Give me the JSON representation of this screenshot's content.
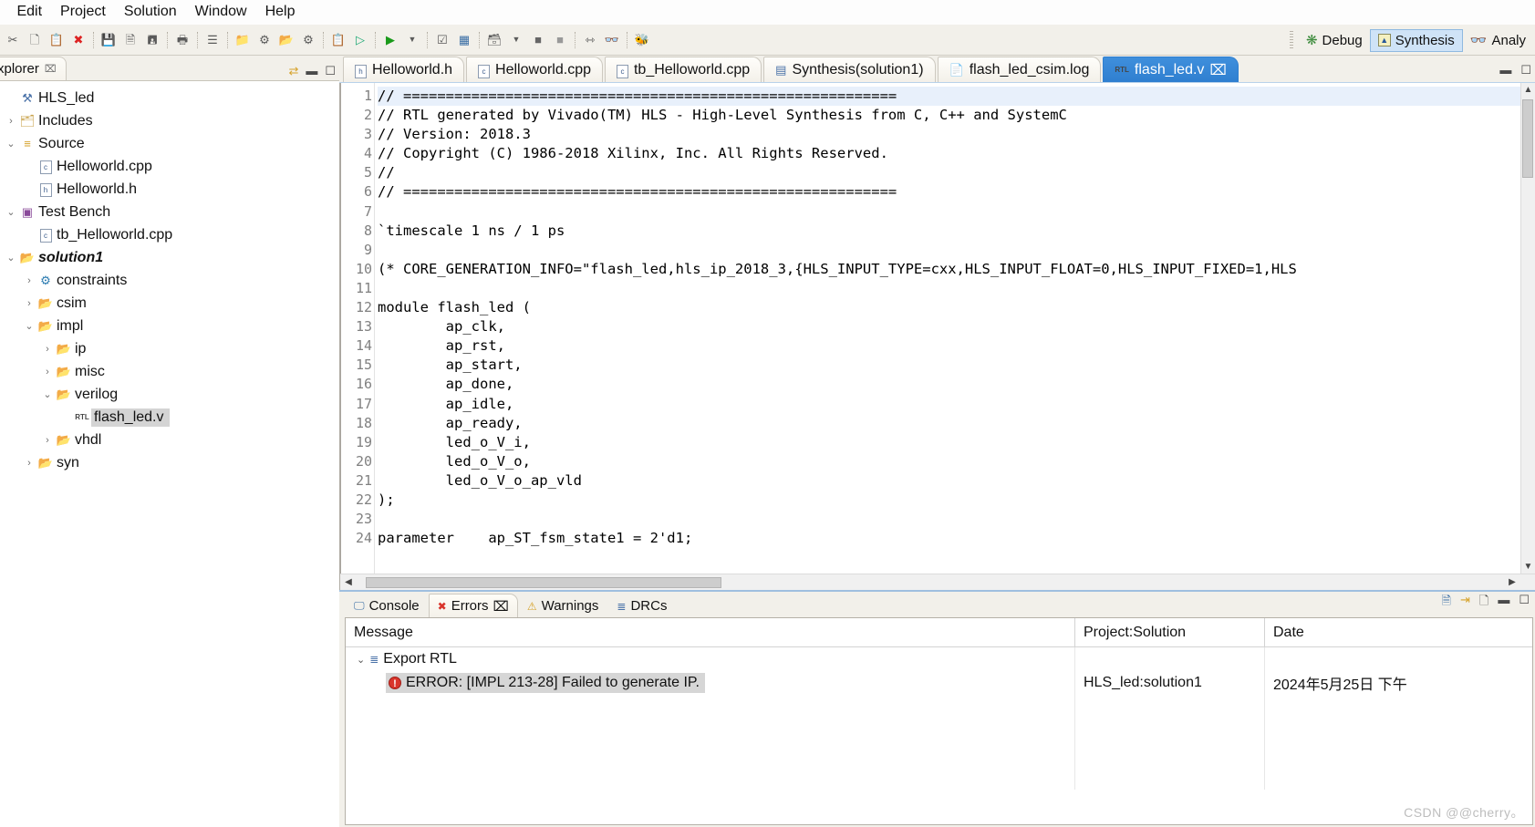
{
  "menu": {
    "items": [
      "Edit",
      "Project",
      "Solution",
      "Window",
      "Help"
    ]
  },
  "toolbar": {
    "icons": [
      "cut-icon",
      "copy-icon",
      "paste-icon",
      "delete-icon",
      "save-icon",
      "save-as-icon",
      "save-all-icon",
      "print-icon",
      "tree-view-icon",
      "new-project-icon",
      "settings-icon",
      "new-solution-icon",
      "run-csynth-icon",
      "report-icon",
      "run-icon",
      "run-arrow-icon",
      "dropdown-arrow-icon",
      "check-icon",
      "grid-icon",
      "export-icon",
      "export-arrow-icon",
      "stop-icon",
      "step-icon",
      "step-over-icon",
      "glasses-icon",
      "debug-bug-icon"
    ]
  },
  "perspectives": {
    "items": [
      {
        "label": "Debug",
        "icon": "debug-perspective-icon",
        "active": false
      },
      {
        "label": "Synthesis",
        "icon": "synthesis-perspective-icon",
        "active": true
      },
      {
        "label": "Analy",
        "icon": "analysis-perspective-icon",
        "active": false
      }
    ]
  },
  "explorer": {
    "tab_label": "xplorer",
    "close_glyph": "⌧",
    "controls": [
      "link-with-editor-icon",
      "minimize-icon",
      "maximize-icon"
    ],
    "tree": [
      {
        "indent": 0,
        "arrow": "",
        "icon": "project-icon",
        "label": "HLS_led",
        "selected": false,
        "bold": false
      },
      {
        "indent": 0,
        "arrow": "›",
        "icon": "includes-icon",
        "label": "Includes",
        "selected": false,
        "bold": false
      },
      {
        "indent": 0,
        "arrow": "⌄",
        "icon": "source-icon",
        "label": "Source",
        "selected": false,
        "bold": false
      },
      {
        "indent": 1,
        "arrow": "",
        "icon": "cpp-file-icon",
        "label": "Helloworld.cpp",
        "selected": false,
        "bold": false
      },
      {
        "indent": 1,
        "arrow": "",
        "icon": "header-file-icon",
        "label": "Helloworld.h",
        "selected": false,
        "bold": false
      },
      {
        "indent": 0,
        "arrow": "⌄",
        "icon": "testbench-icon",
        "label": "Test Bench",
        "selected": false,
        "bold": false
      },
      {
        "indent": 1,
        "arrow": "",
        "icon": "cpp-file-icon",
        "label": "tb_Helloworld.cpp",
        "selected": false,
        "bold": false
      },
      {
        "indent": 0,
        "arrow": "⌄",
        "icon": "solution-folder-icon",
        "label": "solution1",
        "selected": false,
        "bold": true
      },
      {
        "indent": 1,
        "arrow": "›",
        "icon": "constraints-icon",
        "label": "constraints",
        "selected": false,
        "bold": false
      },
      {
        "indent": 1,
        "arrow": "›",
        "icon": "folder-icon",
        "label": "csim",
        "selected": false,
        "bold": false
      },
      {
        "indent": 1,
        "arrow": "⌄",
        "icon": "folder-icon",
        "label": "impl",
        "selected": false,
        "bold": false
      },
      {
        "indent": 2,
        "arrow": "›",
        "icon": "folder-icon",
        "label": "ip",
        "selected": false,
        "bold": false
      },
      {
        "indent": 2,
        "arrow": "›",
        "icon": "folder-icon",
        "label": "misc",
        "selected": false,
        "bold": false
      },
      {
        "indent": 2,
        "arrow": "⌄",
        "icon": "folder-icon",
        "label": "verilog",
        "selected": false,
        "bold": false
      },
      {
        "indent": 3,
        "arrow": "",
        "icon": "rtl-file-icon",
        "label": "flash_led.v",
        "selected": true,
        "bold": false
      },
      {
        "indent": 2,
        "arrow": "›",
        "icon": "folder-icon",
        "label": "vhdl",
        "selected": false,
        "bold": false
      },
      {
        "indent": 1,
        "arrow": "›",
        "icon": "folder-icon",
        "label": "syn",
        "selected": false,
        "bold": false
      }
    ]
  },
  "editor": {
    "tabs": [
      {
        "label": "Helloworld.h",
        "icon": "header-file-icon",
        "active": false,
        "closable": false
      },
      {
        "label": "Helloworld.cpp",
        "icon": "cpp-file-icon",
        "active": false,
        "closable": false
      },
      {
        "label": "tb_Helloworld.cpp",
        "icon": "cpp-file-icon",
        "active": false,
        "closable": false
      },
      {
        "label": "Synthesis(solution1)",
        "icon": "synthesis-report-icon",
        "active": false,
        "closable": false
      },
      {
        "label": "flash_led_csim.log",
        "icon": "log-file-icon",
        "active": false,
        "closable": false
      },
      {
        "label": "flash_led.v",
        "icon": "rtl-file-icon",
        "active": true,
        "closable": true
      }
    ],
    "close_glyph": "⌧",
    "controls": [
      "minimize-icon",
      "maximize-icon"
    ],
    "code_lines": [
      {
        "n": 1,
        "text": "// =========================================================="
      },
      {
        "n": 2,
        "text": "// RTL generated by Vivado(TM) HLS - High-Level Synthesis from C, C++ and SystemC"
      },
      {
        "n": 3,
        "text": "// Version: 2018.3"
      },
      {
        "n": 4,
        "text": "// Copyright (C) 1986-2018 Xilinx, Inc. All Rights Reserved."
      },
      {
        "n": 5,
        "text": "//"
      },
      {
        "n": 6,
        "text": "// =========================================================="
      },
      {
        "n": 7,
        "text": ""
      },
      {
        "n": 8,
        "text": "`timescale 1 ns / 1 ps"
      },
      {
        "n": 9,
        "text": ""
      },
      {
        "n": 10,
        "text": "(* CORE_GENERATION_INFO=\"flash_led,hls_ip_2018_3,{HLS_INPUT_TYPE=cxx,HLS_INPUT_FLOAT=0,HLS_INPUT_FIXED=1,HLS"
      },
      {
        "n": 11,
        "text": ""
      },
      {
        "n": 12,
        "text": "module flash_led ("
      },
      {
        "n": 13,
        "text": "        ap_clk,"
      },
      {
        "n": 14,
        "text": "        ap_rst,"
      },
      {
        "n": 15,
        "text": "        ap_start,"
      },
      {
        "n": 16,
        "text": "        ap_done,"
      },
      {
        "n": 17,
        "text": "        ap_idle,"
      },
      {
        "n": 18,
        "text": "        ap_ready,"
      },
      {
        "n": 19,
        "text": "        led_o_V_i,"
      },
      {
        "n": 20,
        "text": "        led_o_V_o,"
      },
      {
        "n": 21,
        "text": "        led_o_V_o_ap_vld"
      },
      {
        "n": 22,
        "text": ");"
      },
      {
        "n": 23,
        "text": ""
      },
      {
        "n": 24,
        "text": "parameter    ap_ST_fsm_state1 = 2'd1;"
      }
    ]
  },
  "console": {
    "tabs": [
      {
        "label": "Console",
        "icon": "console-icon",
        "active": false,
        "closable": false
      },
      {
        "label": "Errors",
        "icon": "error-icon",
        "active": true,
        "closable": true
      },
      {
        "label": "Warnings",
        "icon": "warning-icon",
        "active": false,
        "closable": false
      },
      {
        "label": "DRCs",
        "icon": "drc-icon",
        "active": false,
        "closable": false
      }
    ],
    "close_glyph": "⌧",
    "controls": [
      "new-console-icon",
      "pin-console-icon",
      "clear-console-icon",
      "minimize-icon",
      "maximize-icon"
    ],
    "columns": [
      "Message",
      "Project:Solution",
      "Date"
    ],
    "rows": [
      {
        "level": 1,
        "icon": "tree-node-icon",
        "message": "Export RTL",
        "arrow": "⌄",
        "project": "",
        "date": "",
        "selected": false,
        "error": false
      },
      {
        "level": 2,
        "icon": "error-icon",
        "message": "ERROR: [IMPL 213-28] Failed to generate IP.",
        "arrow": "",
        "project": "HLS_led:solution1",
        "date": "2024年5月25日 下午",
        "selected": true,
        "error": true
      }
    ]
  },
  "watermark": "CSDN @@cherry。",
  "colors": {
    "accent_blue": "#3f8fdc",
    "selection_gray": "#d4d4d4",
    "error_red": "#d9342b",
    "panel_bg": "#f2f0ea"
  }
}
